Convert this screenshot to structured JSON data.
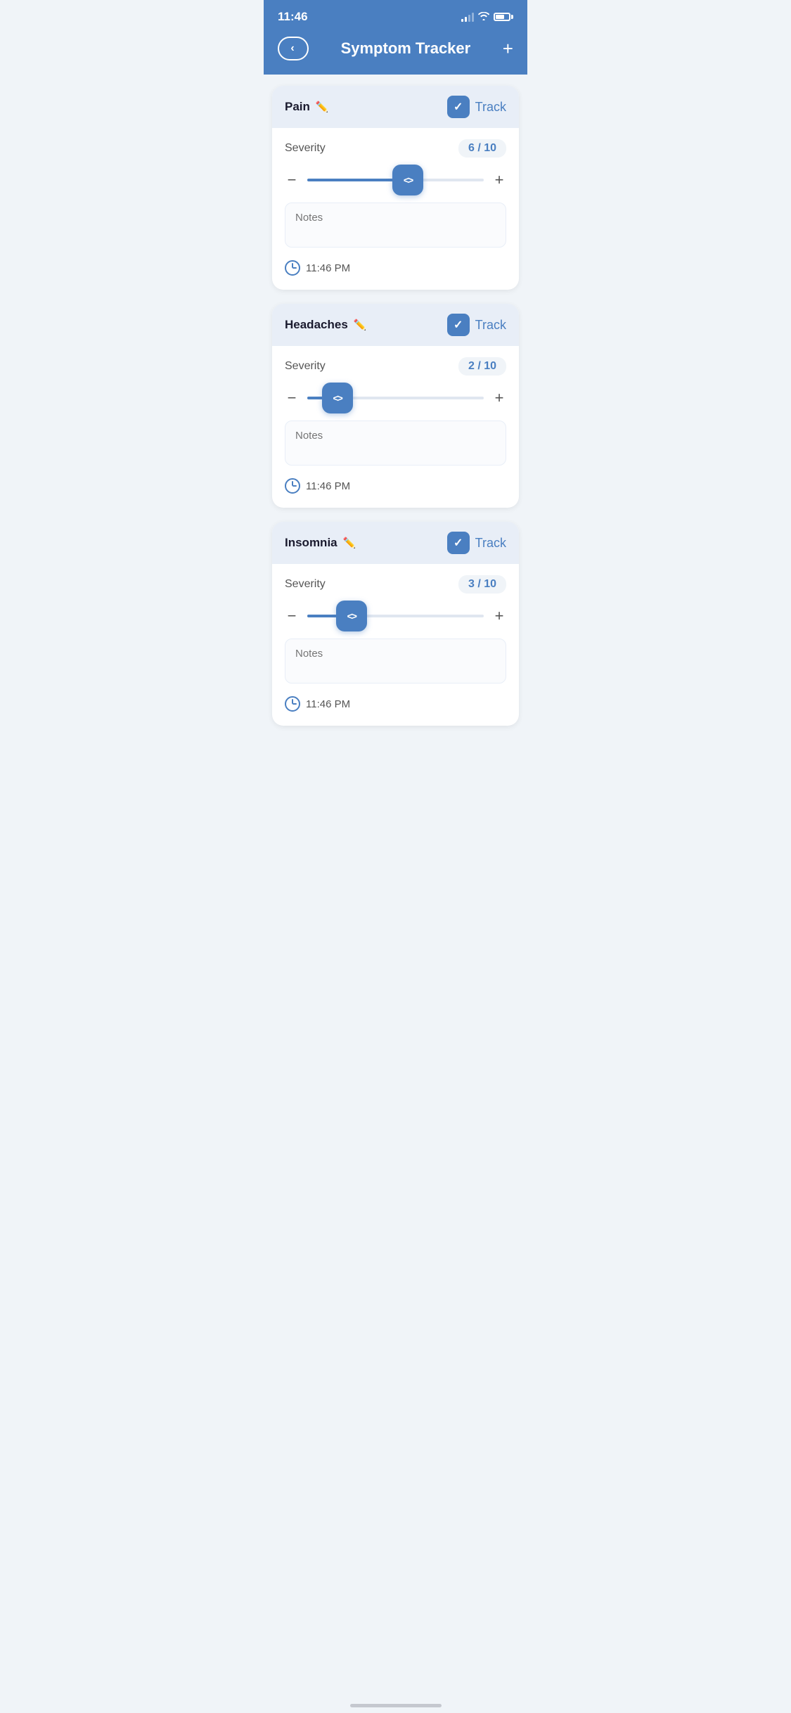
{
  "statusBar": {
    "time": "11:46",
    "batteryLevel": 65
  },
  "header": {
    "title": "Symptom Tracker",
    "backLabel": "<",
    "addLabel": "+"
  },
  "symptoms": [
    {
      "id": "pain",
      "name": "Pain",
      "tracked": true,
      "trackLabel": "Track",
      "severity": 6,
      "maxSeverity": 10,
      "severityDisplay": "6 / 10",
      "sliderPercent": 57,
      "notesPlaceholder": "Notes",
      "time": "11:46 PM"
    },
    {
      "id": "headaches",
      "name": "Headaches",
      "tracked": true,
      "trackLabel": "Track",
      "severity": 2,
      "maxSeverity": 10,
      "severityDisplay": "2 / 10",
      "sliderPercent": 17,
      "notesPlaceholder": "Notes",
      "time": "11:46 PM"
    },
    {
      "id": "insomnia",
      "name": "Insomnia",
      "tracked": true,
      "trackLabel": "Track",
      "severity": 3,
      "maxSeverity": 10,
      "severityDisplay": "3 / 10",
      "sliderPercent": 25,
      "notesPlaceholder": "Notes",
      "time": "11:46 PM"
    }
  ],
  "labels": {
    "severity": "Severity",
    "minus": "−",
    "plus": "+"
  }
}
